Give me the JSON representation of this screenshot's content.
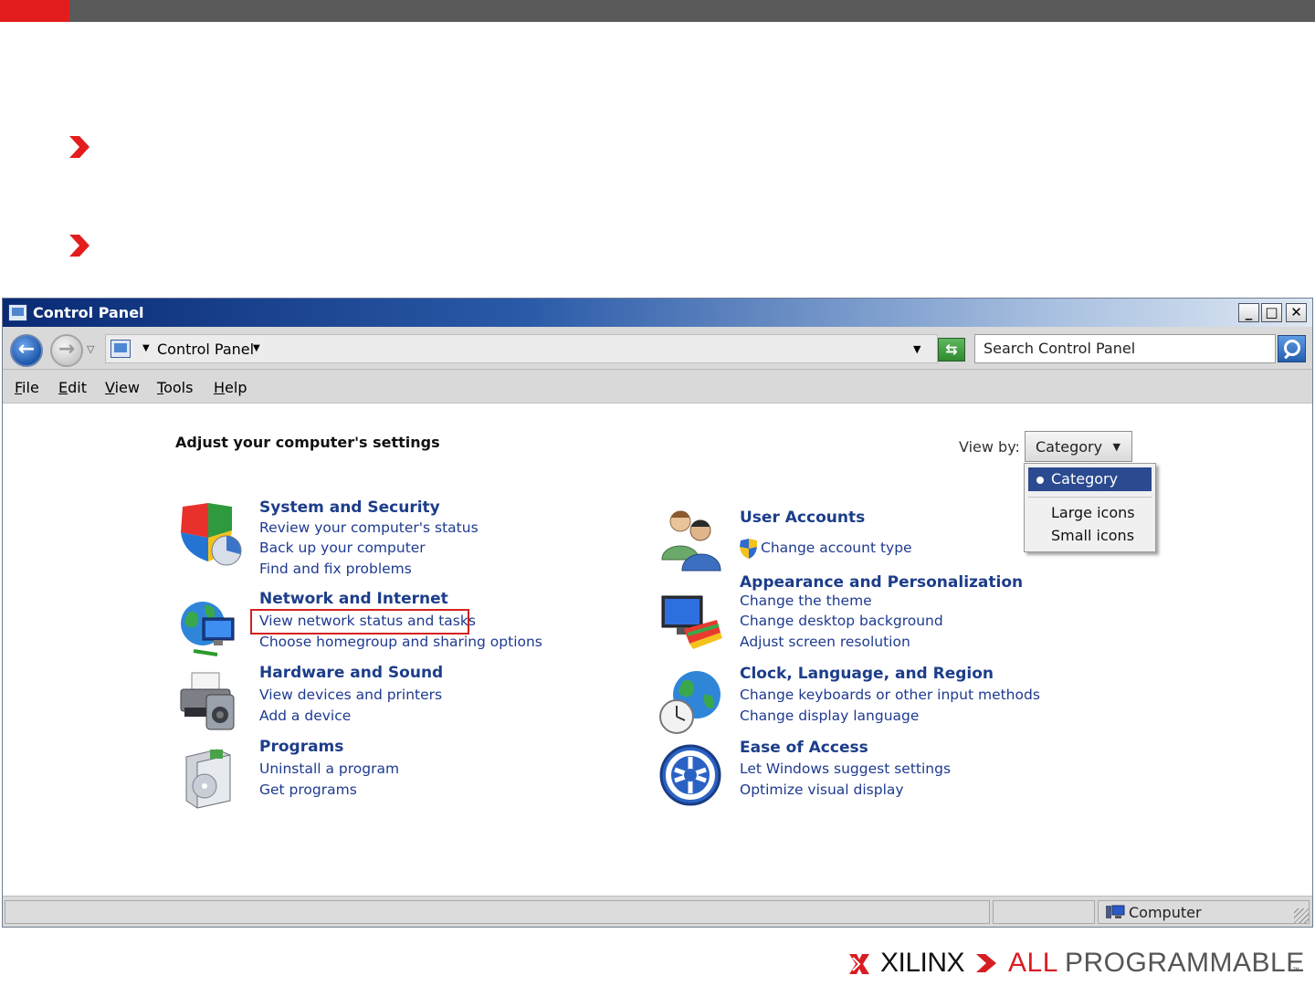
{
  "window": {
    "title": "Control Panel",
    "buttons": {
      "minimize": "_",
      "maximize": "□",
      "close": "✕"
    }
  },
  "address_bar": {
    "back_glyph": "←",
    "forward_glyph": "→",
    "breadcrumb": "Control Panel",
    "refresh_glyph": "⇆",
    "search_placeholder": "Search Control Panel"
  },
  "menu": [
    {
      "accel": "F",
      "rest": "ile"
    },
    {
      "accel": "E",
      "rest": "dit"
    },
    {
      "accel": "V",
      "rest": "iew"
    },
    {
      "accel": "T",
      "rest": "ools"
    },
    {
      "accel": "H",
      "rest": "elp"
    }
  ],
  "content": {
    "heading": "Adjust your computer's settings",
    "view_by": {
      "label": "View by:",
      "selected": "Category",
      "options": [
        "Category",
        "Large icons",
        "Small icons"
      ]
    },
    "left_categories": [
      {
        "icon": "shield-icon",
        "title": "System and Security",
        "links": [
          "Review your computer's status",
          "Back up your computer",
          "Find and fix problems"
        ]
      },
      {
        "icon": "network-globe-icon",
        "title": "Network and Internet",
        "links": [
          "View network status and tasks",
          "Choose homegroup and sharing options"
        ]
      },
      {
        "icon": "printer-icon",
        "title": "Hardware and Sound",
        "links": [
          "View devices and printers",
          "Add a device"
        ]
      },
      {
        "icon": "programs-box-icon",
        "title": "Programs",
        "links": [
          "Uninstall a program",
          "Get programs"
        ]
      }
    ],
    "right_categories": [
      {
        "icon": "users-icon",
        "title": "User Accounts",
        "links": [
          "Change account type"
        ]
      },
      {
        "icon": "monitor-palette-icon",
        "title": "Appearance and Personalization",
        "links": [
          "Change the theme",
          "Change desktop background",
          "Adjust screen resolution"
        ]
      },
      {
        "icon": "globe-clock-icon",
        "title": "Clock, Language, and Region",
        "links": [
          "Change keyboards or other input methods",
          "Change display language"
        ]
      },
      {
        "icon": "ease-of-access-icon",
        "title": "Ease of Access",
        "links": [
          "Let Windows suggest settings",
          "Optimize visual display"
        ]
      }
    ]
  },
  "status_bar": {
    "text": "Computer"
  },
  "footer": {
    "brand": "XILINX",
    "tagline_a": "ALL",
    "tagline_b": "PROGRAMMABLE",
    "tm": "™"
  },
  "colors": {
    "slide_bar": "#5a5a5a",
    "slide_accent": "#e31d1d",
    "link_blue": "#1e3a90",
    "highlight_red": "#d52020"
  }
}
